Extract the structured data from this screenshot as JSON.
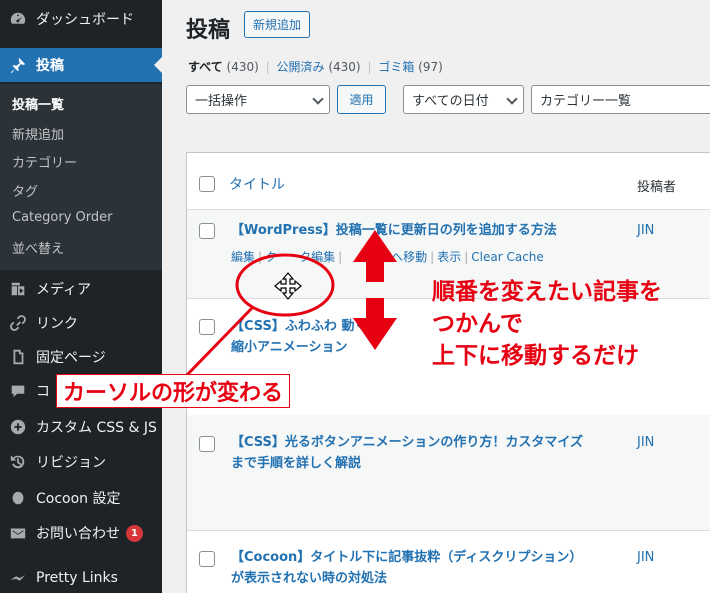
{
  "sidebar": {
    "items": [
      {
        "label": "ダッシュボード",
        "icon": "dashboard-icon"
      },
      {
        "label": "投稿",
        "icon": "pin-icon"
      },
      {
        "label": "メディア",
        "icon": "media-icon"
      },
      {
        "label": "リンク",
        "icon": "link-icon"
      },
      {
        "label": "固定ページ",
        "icon": "page-icon"
      },
      {
        "label": "コ",
        "icon": "comment-icon"
      },
      {
        "label": "カスタム CSS & JS",
        "icon": "plus-circle-icon"
      },
      {
        "label": "リビジョン",
        "icon": "history-icon"
      },
      {
        "label": "Cocoon 設定",
        "icon": "cocoon-icon"
      },
      {
        "label": "お問い合わせ",
        "icon": "mail-icon",
        "badge": "1"
      },
      {
        "label": "Pretty Links",
        "icon": "pretty-links-icon"
      }
    ],
    "submenu": [
      "投稿一覧",
      "新規追加",
      "カテゴリー",
      "タグ",
      "Category Order",
      "並べ替え"
    ]
  },
  "header": {
    "title": "投稿",
    "add_new": "新規追加"
  },
  "views": {
    "all": "すべて",
    "all_count": "(430)",
    "published": "公開済み",
    "published_count": "(430)",
    "trash": "ゴミ箱",
    "trash_count": "(97)"
  },
  "filters": {
    "bulk": "一括操作",
    "apply": "適用",
    "dates": "すべての日付",
    "category": "カテゴリー一覧"
  },
  "table": {
    "col_title": "タイトル",
    "col_author": "投稿者",
    "rows": [
      {
        "title": "【WordPress】投稿一覧に更新日の列を追加する方法",
        "author": "JIN"
      },
      {
        "title": "【CSS】ふわふわ     動く",
        "title_line2": "縮小アニメーション",
        "author": ""
      },
      {
        "title": "【CSS】光るボタンアニメーションの作り方！カスタマイズ",
        "title_line2": "まで手順を詳しく解説",
        "author": "JIN"
      },
      {
        "title": "【Cocoon】タイトル下に記事抜粋（ディスクリプション）",
        "title_line2": "が表示されない時の対処法",
        "author": "JIN"
      }
    ],
    "row_actions": [
      "編集",
      "クイック編集",
      "ゴミ箱へ移動",
      "表示",
      "Clear Cache"
    ],
    "row_actions_shown": [
      "編集",
      "ク",
      "ク編集",
      "ミ箱へ移動",
      "表示",
      "Clear Cache"
    ]
  },
  "annotations": {
    "cursor_note": "カーソルの形が変わる",
    "drag_note_1": "順番を変えたい記事を",
    "drag_note_2": "つかんで",
    "drag_note_3": "上下に移動するだけ",
    "color": "#e60012"
  }
}
